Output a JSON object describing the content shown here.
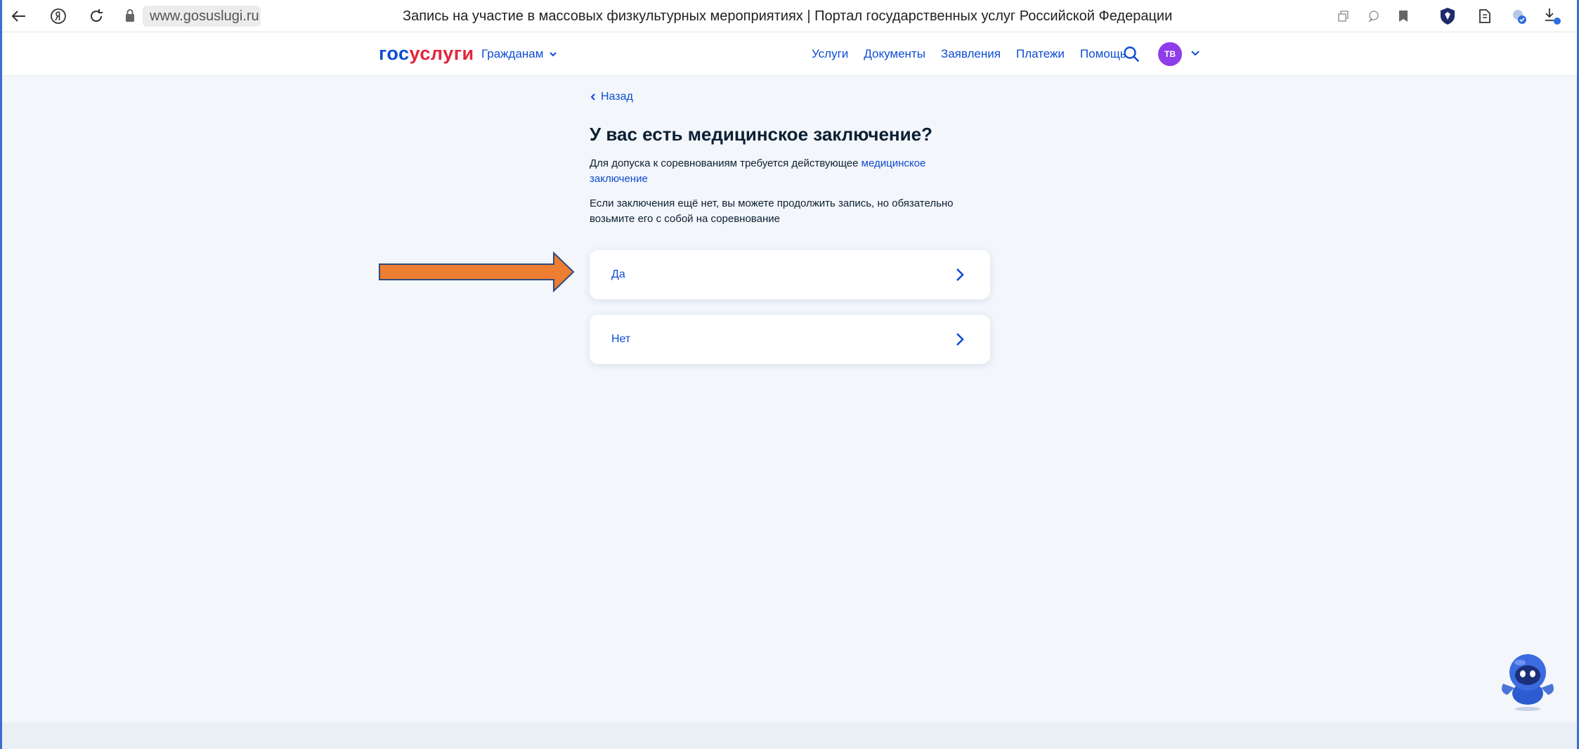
{
  "browser": {
    "url": "www.gosuslugi.ru",
    "tab_title": "Запись на участие в массовых физкультурных мероприятиях | Портал государственных услуг Российской Федерации"
  },
  "header": {
    "logo_part1": "гос",
    "logo_part2": "услуги",
    "citizens_label": "Гражданам",
    "nav": [
      "Услуги",
      "Документы",
      "Заявления",
      "Платежи",
      "Помощь"
    ],
    "avatar_initials": "ТВ"
  },
  "page": {
    "back_label": "Назад",
    "title": "У вас есть медицинское заключение?",
    "para1_text": "Для допуска к соревнованиям требуется действующее ",
    "para1_link": "медицинское заключение",
    "para2": "Если заключения ещё нет, вы можете продолжить запись, но обязательно возьмите его с собой на соревнование",
    "options": [
      {
        "label": "Да"
      },
      {
        "label": "Нет"
      }
    ]
  },
  "colors": {
    "brand_blue": "#0d4cd3",
    "brand_red": "#e3253c",
    "avatar_purple": "#8f3dea",
    "annotation_arrow": "#ed7d31",
    "page_bg": "#f3f6fb"
  },
  "icons": [
    "back-arrow-icon",
    "yandex-icon",
    "reload-icon",
    "lock-icon",
    "search-icon",
    "chevron-down-icon",
    "chevron-right-icon",
    "robot-assistant-icon"
  ]
}
